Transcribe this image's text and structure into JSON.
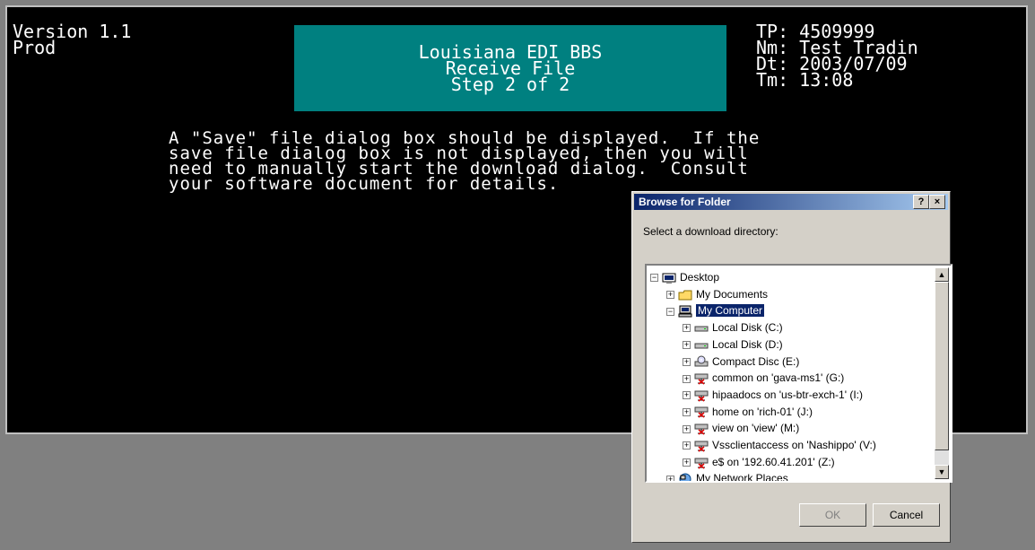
{
  "terminal": {
    "version_line1": "Version 1.1",
    "version_line2": "Prod",
    "header": {
      "line1": "Louisiana EDI BBS",
      "line2": "Receive  File",
      "line3": "Step 2 of 2"
    },
    "status": {
      "tp_label": "TP:",
      "tp_value": "4509999",
      "nm_label": "Nm:",
      "nm_value": "Test Tradin",
      "dt_label": "Dt:",
      "dt_value": "2003/07/09",
      "tm_label": "Tm:",
      "tm_value": "13:08"
    },
    "message_lines": [
      "A \"Save\" file dialog box should be displayed.  If the",
      "save file dialog box is not displayed, then you will",
      "need to manually start the download dialog.  Consult",
      "your software document for details."
    ]
  },
  "dialog": {
    "title": "Browse for Folder",
    "help_label": "?",
    "close_label": "×",
    "prompt": "Select a download directory:",
    "tree": [
      {
        "label": "Desktop",
        "icon": "desktop-icon",
        "expander": "−"
      },
      {
        "label": "My Documents",
        "icon": "folder-icon",
        "expander": "+"
      },
      {
        "label": "My Computer",
        "icon": "computer-icon",
        "expander": "−",
        "selected": true
      },
      {
        "label": "Local Disk (C:)",
        "icon": "hard-drive-icon",
        "expander": "+"
      },
      {
        "label": "Local Disk (D:)",
        "icon": "hard-drive-icon",
        "expander": "+"
      },
      {
        "label": "Compact Disc (E:)",
        "icon": "cd-drive-icon",
        "expander": "+"
      },
      {
        "label": "common on 'gava-ms1' (G:)",
        "icon": "network-drive-icon",
        "expander": "+"
      },
      {
        "label": "hipaadocs on 'us-btr-exch-1' (I:)",
        "icon": "network-drive-icon",
        "expander": "+"
      },
      {
        "label": "home on 'rich-01' (J:)",
        "icon": "network-drive-icon",
        "expander": "+"
      },
      {
        "label": "view on 'view' (M:)",
        "icon": "network-drive-icon",
        "expander": "+"
      },
      {
        "label": "Vssclientaccess on 'Nashippo' (V:)",
        "icon": "network-drive-icon",
        "expander": "+"
      },
      {
        "label": "e$ on '192.60.41.201' (Z:)",
        "icon": "network-drive-icon",
        "expander": "+"
      },
      {
        "label": "My Network Places",
        "icon": "network-places-icon",
        "expander": "+"
      }
    ],
    "ok_label": "OK",
    "cancel_label": "Cancel"
  }
}
